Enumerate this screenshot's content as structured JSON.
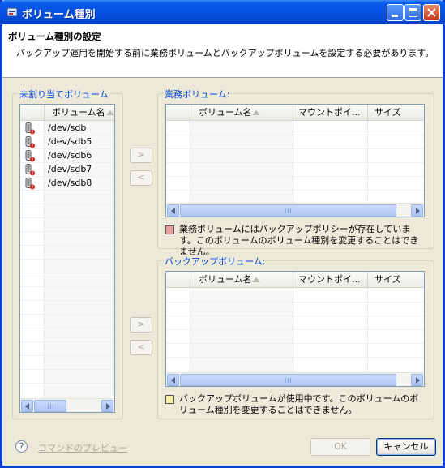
{
  "window": {
    "title": "ボリューム種別"
  },
  "header": {
    "title": "ボリューム種別の設定",
    "description": "バックアップ運用を開始する前に業務ボリュームとバックアップボリュームを設定する必要があります。"
  },
  "unassigned": {
    "label": "未割り当てボリューム",
    "column": "ボリューム名",
    "rows": [
      "/dev/sdb",
      "/dev/sdb5",
      "/dev/sdb6",
      "/dev/sdb7",
      "/dev/sdb8"
    ],
    "row_icon": "disk-warning-icon"
  },
  "business": {
    "label": "業務ボリューム:",
    "columns": [
      "ボリューム名",
      "マウントポイ...",
      "サイズ"
    ],
    "move_right": ">",
    "move_left": "<",
    "legend_color": "#e8a0a0",
    "legend_text": "業務ボリュームにはバックアップポリシーが存在しています。このボリュームのボリューム種別を変更することはできません。"
  },
  "backup": {
    "label": "バックアップボリューム:",
    "columns": [
      "ボリューム名",
      "マウントポイ...",
      "サイズ"
    ],
    "move_right": ">",
    "move_left": "<",
    "legend_color": "#f5f0a8",
    "legend_text": "バックアップボリュームが使用中です。このボリュームのボリューム種別を変更することはできません。"
  },
  "footer": {
    "help_icon": "help-icon",
    "preview_link": "コマンドのプレビュー",
    "ok": "OK",
    "cancel": "キャンセル"
  }
}
